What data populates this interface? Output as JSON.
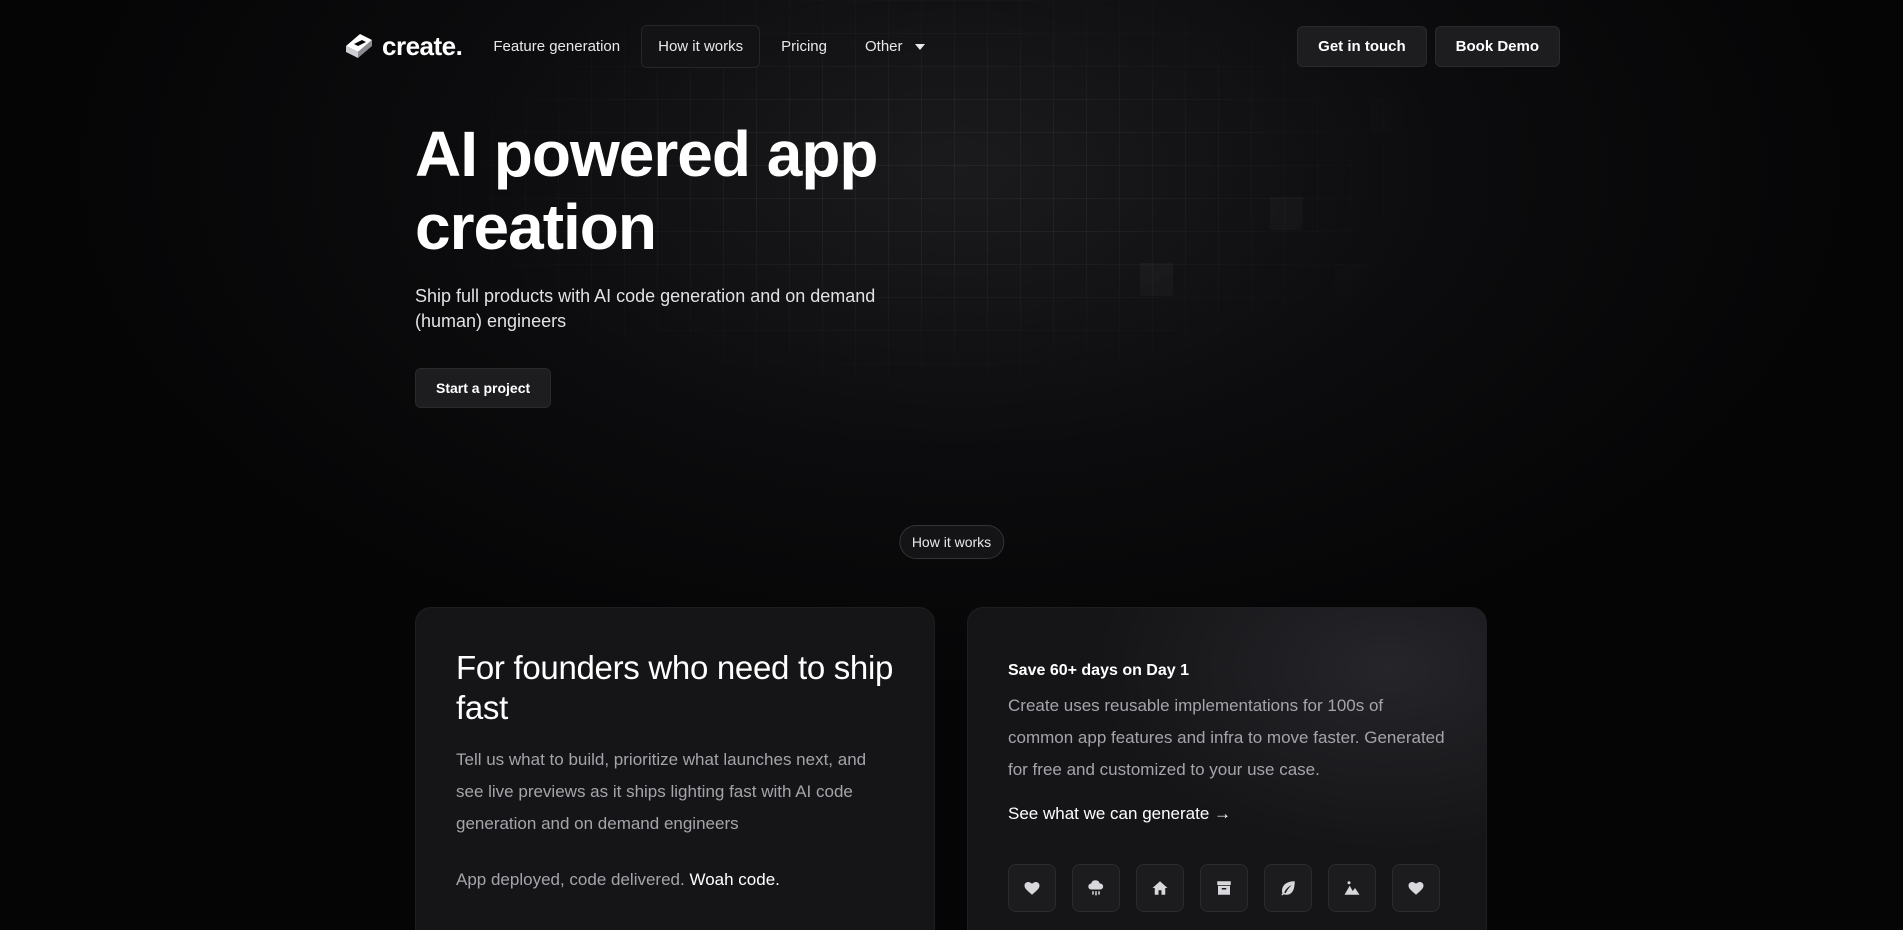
{
  "brand": {
    "name": "create."
  },
  "nav": {
    "links": [
      "Feature generation",
      "How it works",
      "Pricing",
      "Other"
    ],
    "get_in_touch": "Get in touch",
    "book_demo": "Book Demo"
  },
  "hero": {
    "title": "AI powered app creation",
    "subtitle": "Ship full products with AI code generation and on demand (human) engineers",
    "cta": "Start a project"
  },
  "section": {
    "pill": "How it works"
  },
  "card_left": {
    "title": "For founders who need to ship fast",
    "body": "Tell us what to build, prioritize what launches next, and see live previews as it ships lighting fast with AI code generation and on demand engineers",
    "tagline_prefix": "App deployed, code delivered. ",
    "tagline_strong": "Woah code."
  },
  "card_right": {
    "heading": "Save 60+ days on Day 1",
    "body": "Create uses reusable implementations for 100s of common app features and infra to move faster. Generated for free and customized to your use case.",
    "link": "See what we can generate →",
    "icons": [
      "heart-icon",
      "cloud-rain-icon",
      "home-icon",
      "archive-icon",
      "leaf-icon",
      "mountain-icon",
      "heart-icon"
    ]
  },
  "colors": {
    "background": "#050506",
    "card": "#151517",
    "button": "#1d1d20",
    "muted_text": "#a4a4ab"
  }
}
